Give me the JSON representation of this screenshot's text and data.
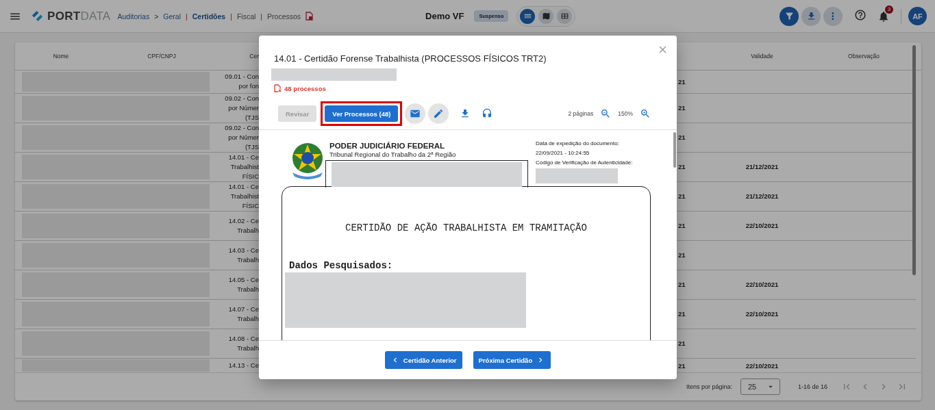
{
  "topbar": {
    "logo": {
      "part_1": "PORT",
      "part_2": "DATA"
    },
    "breadcrumbs": [
      {
        "label": "Auditorias"
      },
      {
        "label": "Geral"
      }
    ],
    "crumb_separator": ">",
    "modules": [
      {
        "label": "Certidões",
        "selected": true,
        "separator": "|"
      },
      {
        "label": "Fiscal",
        "selected": false,
        "separator": "|"
      },
      {
        "label": "Processos",
        "selected": false,
        "separator": "|"
      }
    ],
    "company": "Demo VF",
    "status_badge": "Suspenso",
    "views": [
      {
        "kind": "list",
        "selected": true
      },
      {
        "kind": "map",
        "selected": false
      },
      {
        "kind": "table",
        "selected": false
      }
    ],
    "actions": [
      {
        "kind": "filter",
        "selected": true
      },
      {
        "kind": "download",
        "selected": false
      },
      {
        "kind": "more",
        "selected": false
      }
    ],
    "notifications": "3",
    "avatar": "AF"
  },
  "table": {
    "columns": [
      {
        "label": "Nome"
      },
      {
        "label": "CPF/CNPJ"
      },
      {
        "label": "Cer"
      },
      {
        "label": "Validade"
      },
      {
        "label": "Observação"
      }
    ],
    "rows": [
      {
        "redacted": true,
        "column_3": [
          "09.01 - Con",
          "por fon"
        ],
        "column_4": "21"
      },
      {
        "redacted": true,
        "column_3": [
          "09.02 - Con",
          "por Númer",
          "(TJS"
        ],
        "column_4": "21"
      },
      {
        "redacted": true,
        "column_3": [
          "09.02 - Con",
          "por Númer",
          "(TJS"
        ],
        "column_4": "21"
      },
      {
        "redacted": true,
        "column_3": [
          "14.01 - Ce",
          "Trabalhist",
          "FÍSIC"
        ],
        "column_4": "21",
        "validade": "21/12/2021"
      },
      {
        "redacted": true,
        "column_3": [
          "14.01 - Ce",
          "Trabalhist",
          "FÍSIC"
        ],
        "column_4": "21",
        "validade": "21/12/2021"
      },
      {
        "redacted": true,
        "column_3": [
          "14.02 - Ce",
          "Trabalh"
        ],
        "column_4": "21",
        "validade": "22/10/2021"
      },
      {
        "redacted": true,
        "column_3": [
          "14.03 - Ce",
          "Trabalh"
        ],
        "column_4": "21"
      },
      {
        "redacted": true,
        "column_3": [
          "14.05 - Ce",
          "Trabalh"
        ],
        "column_4": "21",
        "validade": "22/10/2021"
      },
      {
        "redacted": true,
        "column_3": [
          "14.07 - Ce",
          "Trabalh"
        ],
        "column_4": "21",
        "validade": "22/10/2021"
      },
      {
        "redacted": true,
        "column_3": [
          "14.08 - Ce",
          "Trabalh"
        ],
        "column_4": "21"
      },
      {
        "redacted": true,
        "column_3": [
          "14.13 - Ce"
        ],
        "column_4": "21",
        "validade": "22/10/2021"
      }
    ]
  },
  "paginator": {
    "label": "Itens por página:",
    "page_size": "25",
    "range": "1-16 de 16"
  },
  "modal": {
    "title": "14.01 - Certidão Forense Trabalhista (PROCESSOS FÍSICOS TRT2)",
    "subtitle_redacted": true,
    "status": "48 processos",
    "buttons": [
      {
        "label": "Revisar",
        "disabled": true,
        "highlighted": false
      },
      {
        "label": "Ver Processos (48)",
        "disabled": false,
        "highlighted": true
      }
    ],
    "page_count": "2 páginas",
    "zoom": "150%",
    "document": {
      "org": "PODER JUDICIÁRIO FEDERAL",
      "court": "Tribunal Regional do Trabalho da 2ª Região",
      "issued_label": "Data de expedição do documento:",
      "issued": "22/09/2021 - 10:24:55",
      "code_label": "Código de Verificação de Autenticidade:",
      "heading": "CERTIDÃO DE AÇÃO TRABALHISTA EM TRAMITAÇÃO",
      "search_label": "Dados Pesquisados:"
    },
    "footer_buttons": [
      {
        "label": "Certidão Anterior",
        "kind": "prev"
      },
      {
        "label": "Próxima Certidão",
        "kind": "next"
      }
    ]
  }
}
